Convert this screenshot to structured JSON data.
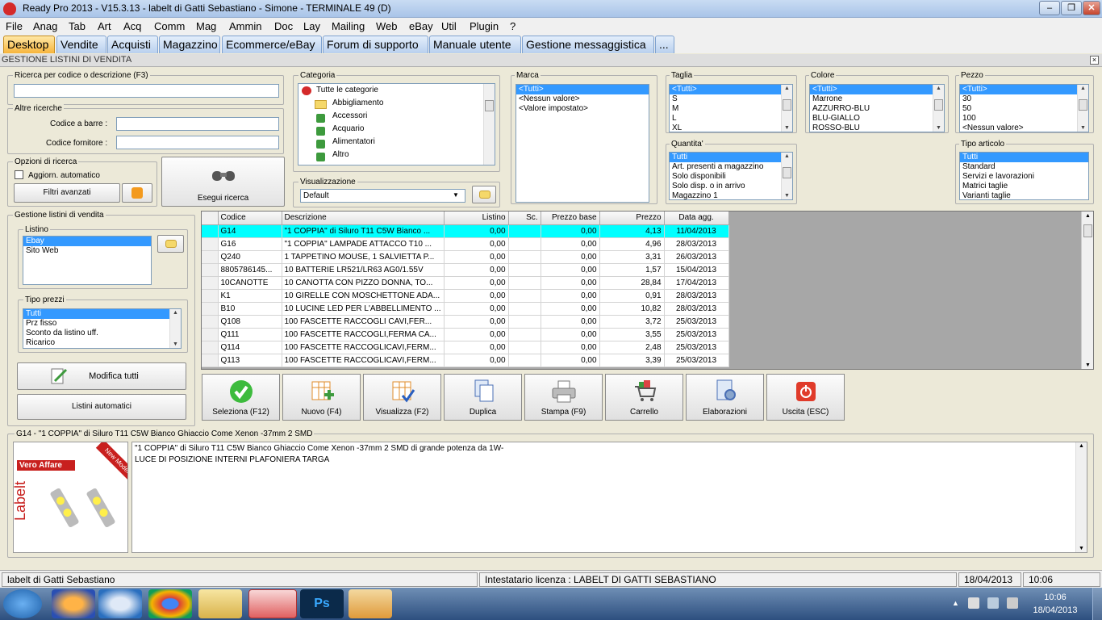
{
  "window": {
    "title": "Ready Pro 2013 - V15.3.13 - labelt di Gatti Sebastiano - Simone - TERMINALE 49 (D)"
  },
  "menu": [
    "File",
    "Anag",
    "Tab",
    "Art",
    "Acq",
    "Comm",
    "Mag",
    "Ammin",
    "Doc",
    "Lay",
    "Mailing",
    "Web",
    "eBay",
    "Util",
    "Plugin",
    "?"
  ],
  "tabs": [
    "Desktop",
    "Vendite",
    "Acquisti",
    "Magazzino",
    "Ecommerce/eBay",
    "Forum di supporto",
    "Manuale utente",
    "Gestione messaggistica",
    "..."
  ],
  "section_title": "GESTIONE LISTINI DI VENDITA",
  "search": {
    "group": "Ricerca per codice o descrizione (F3)",
    "value": "",
    "other_group": "Altre ricerche",
    "barcode_label": "Codice a barre :",
    "supplier_label": "Codice fornitore :",
    "options_group": "Opzioni di ricerca",
    "auto_update_label": "Aggiorn. automatico",
    "auto_update_checked": false,
    "advanced_filters": "Filtri avanzati",
    "execute": "Esegui ricerca"
  },
  "categoria": {
    "group": "Categoria",
    "items": [
      "Tutte le categorie",
      "Abbigliamento",
      "Accessori",
      "Acquario",
      "Alimentatori",
      "Altro"
    ]
  },
  "visualizzazione": {
    "group": "Visualizzazione",
    "value": "Default"
  },
  "marca": {
    "group": "Marca",
    "items": [
      "<Tutti>",
      "<Nessun valore>",
      "<Valore impostato>"
    ]
  },
  "taglia": {
    "group": "Taglia",
    "items": [
      "<Tutti>",
      "S",
      "M",
      "L",
      "XL"
    ]
  },
  "colore": {
    "group": "Colore",
    "items": [
      "<Tutti>",
      "Marrone",
      "AZZURRO-BLU",
      "BLU-GIALLO",
      "ROSSO-BLU"
    ]
  },
  "pezzo": {
    "group": "Pezzo",
    "items": [
      "<Tutti>",
      "30",
      "50",
      "100",
      "<Nessun valore>"
    ]
  },
  "quantita": {
    "group": "Quantita'",
    "items": [
      "Tutti",
      "Art. presenti a magazzino",
      "Solo disponibili",
      "Solo disp. o in arrivo",
      "Magazzino 1"
    ]
  },
  "tipo_articolo": {
    "group": "Tipo articolo",
    "items": [
      "Tutti",
      "Standard",
      "Servizi e lavorazioni",
      "Matrici taglie",
      "Varianti taglie"
    ]
  },
  "gestione": {
    "group": "Gestione listini di vendita",
    "listino_group": "Listino",
    "listino_items": [
      "Ebay",
      "Sito Web"
    ],
    "tipo_prezzi_group": "Tipo prezzi",
    "tipo_prezzi_items": [
      "Tutti",
      "Prz fisso",
      "Sconto da listino uff.",
      "Ricarico"
    ],
    "modify_all": "Modifica tutti",
    "auto_lists": "Listini automatici"
  },
  "table": {
    "columns": [
      "Codice",
      "Descrizione",
      "Listino",
      "Sc.",
      "Prezzo base",
      "Prezzo",
      "Data agg."
    ],
    "rows": [
      [
        "G14",
        "\"1 COPPIA\" di Siluro T11 C5W Bianco ...",
        "0,00",
        "",
        "0,00",
        "4,13",
        "11/04/2013"
      ],
      [
        "G16",
        "\"1 COPPIA\" LAMPADE ATTACCO T10 ...",
        "0,00",
        "",
        "0,00",
        "4,96",
        "28/03/2013"
      ],
      [
        "Q240",
        "1 TAPPETINO MOUSE, 1 SALVIETTA P...",
        "0,00",
        "",
        "0,00",
        "3,31",
        "26/03/2013"
      ],
      [
        "8805786145...",
        "10 BATTERIE LR521/LR63 AG0/1.55V",
        "0,00",
        "",
        "0,00",
        "1,57",
        "15/04/2013"
      ],
      [
        "10CANOTTE",
        "10 CANOTTA CON PIZZO DONNA, TO...",
        "0,00",
        "",
        "0,00",
        "28,84",
        "17/04/2013"
      ],
      [
        "K1",
        "10 GIRELLE CON MOSCHETTONE ADA...",
        "0,00",
        "",
        "0,00",
        "0,91",
        "28/03/2013"
      ],
      [
        "B10",
        "10 LUCINE LED PER L'ABBELLIMENTO ...",
        "0,00",
        "",
        "0,00",
        "10,82",
        "28/03/2013"
      ],
      [
        "Q108",
        "100 FASCETTE RACCOGLI CAVI,FER...",
        "0,00",
        "",
        "0,00",
        "3,72",
        "25/03/2013"
      ],
      [
        "Q111",
        "100 FASCETTE RACCOGLI,FERMA CA...",
        "0,00",
        "",
        "0,00",
        "3,55",
        "25/03/2013"
      ],
      [
        "Q114",
        "100 FASCETTE RACCOGLICAVI,FERM...",
        "0,00",
        "",
        "0,00",
        "2,48",
        "25/03/2013"
      ],
      [
        "Q113",
        "100 FASCETTE RACCOGLICAVI,FERM...",
        "0,00",
        "",
        "0,00",
        "3,39",
        "25/03/2013"
      ]
    ],
    "selected_row": 0
  },
  "actions": [
    "Seleziona (F12)",
    "Nuovo (F4)",
    "Visualizza (F2)",
    "Duplica",
    "Stampa (F9)",
    "Carrello",
    "Elaborazioni",
    "Uscita (ESC)"
  ],
  "detail": {
    "title": "G14 - \"1 COPPIA\" di Siluro T11 C5W Bianco Ghiaccio Come Xenon -37mm 2 SMD",
    "image_banner": "Vero Affare",
    "image_brand": "Labelt",
    "image_corner": "New Model",
    "description_line1": "\"1 COPPIA\" di Siluro T11 C5W Bianco Ghiaccio Come Xenon -37mm 2 SMD di grande potenza da 1W-",
    "description_line2": "LUCE DI POSIZIONE INTERNI PLAFONIERA TARGA"
  },
  "status": {
    "company": "labelt di Gatti Sebastiano",
    "license": "Intestatario licenza : LABELT DI GATTI SEBASTIANO",
    "date": "18/04/2013",
    "time": "10:06"
  },
  "taskbar": {
    "clock_time": "10:06",
    "clock_date": "18/04/2013",
    "ps_label": "Ps"
  }
}
